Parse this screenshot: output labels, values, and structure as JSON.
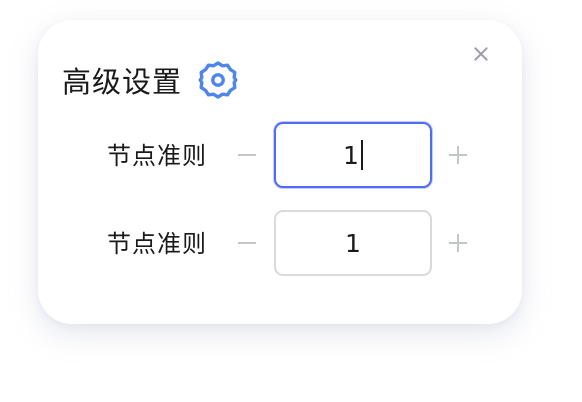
{
  "dialog": {
    "title": "高级设置",
    "close_icon": "close-icon",
    "settings_icon": "gear-icon",
    "accent_color": "#4f6cf5"
  },
  "fields": [
    {
      "label": "节点准则",
      "value": "1",
      "focused": true,
      "decrement_icon": "minus-icon",
      "increment_icon": "plus-icon"
    },
    {
      "label": "节点准则",
      "value": "1",
      "focused": false,
      "decrement_icon": "minus-icon",
      "increment_icon": "plus-icon"
    }
  ]
}
